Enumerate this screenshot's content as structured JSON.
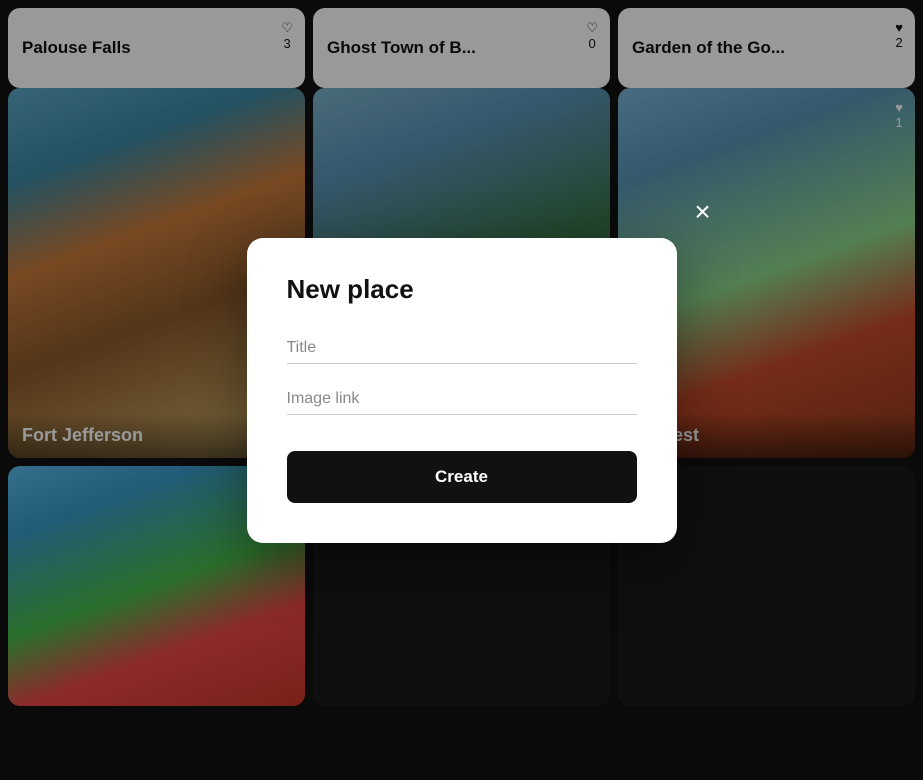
{
  "cards": {
    "top_row": [
      {
        "id": "palouse-falls",
        "title": "Palouse Falls",
        "heart_count": "3",
        "filled_heart": false,
        "img_class": "card-img-palouse"
      },
      {
        "id": "ghost-town",
        "title": "Ghost Town of B...",
        "heart_count": "0",
        "filled_heart": false,
        "img_class": "card-img-ghost"
      },
      {
        "id": "garden",
        "title": "Garden of the Go...",
        "heart_count": "2",
        "filled_heart": true,
        "img_class": "card-img-garden"
      }
    ],
    "mid_row": [
      {
        "id": "fort-jefferson",
        "title": "Fort Jefferson",
        "heart_count": "",
        "filled_heart": false,
        "img_class": "card-img-fort"
      },
      {
        "id": "forest",
        "title": "r Forest",
        "heart_count": "1",
        "filled_heart": true,
        "img_class": "card-img-forest"
      }
    ],
    "bottom_row": [
      {
        "id": "beach",
        "title": "",
        "heart_count": "",
        "filled_heart": false,
        "img_class": "card-img-beach"
      },
      {
        "id": "black1",
        "title": "",
        "heart_count": "",
        "filled_heart": false,
        "img_class": "card-img-black"
      },
      {
        "id": "black2",
        "title": "",
        "heart_count": "",
        "filled_heart": false,
        "img_class": "card-img-black"
      }
    ]
  },
  "modal": {
    "title": "New place",
    "title_placeholder": "Title",
    "image_link_placeholder": "Image link",
    "create_button_label": "Create",
    "close_icon": "×"
  }
}
